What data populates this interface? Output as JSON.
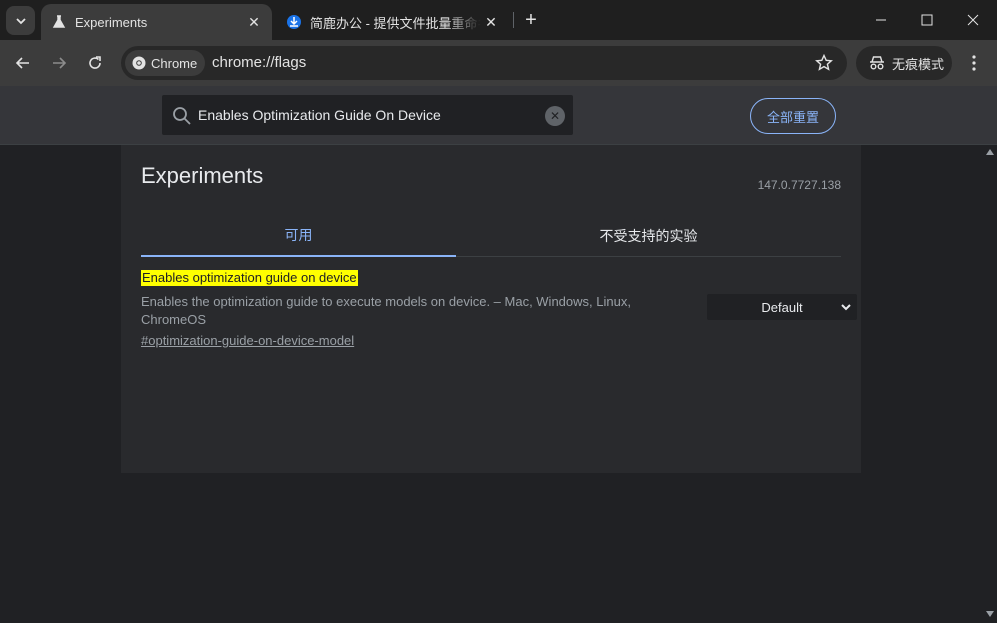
{
  "browser": {
    "tabs": [
      {
        "title": "Experiments",
        "favicon": "flask-icon",
        "active": true
      },
      {
        "title": "简鹿办公 - 提供文件批量重命名",
        "favicon": "download-circle-icon",
        "active": false
      }
    ],
    "omnibox": {
      "chip_label": "Chrome",
      "url": "chrome://flags"
    },
    "incognito_label": "无痕模式"
  },
  "flags_header": {
    "search_value": "Enables Optimization Guide On Device",
    "reset_label": "全部重置"
  },
  "page": {
    "title": "Experiments",
    "version": "147.0.7727.138",
    "tabs": [
      {
        "label": "可用",
        "selected": true
      },
      {
        "label": "不受支持的实验",
        "selected": false
      }
    ],
    "flag": {
      "name": "Enables optimization guide on device",
      "description": "Enables the optimization guide to execute models on device. – Mac, Windows, Linux, ChromeOS",
      "link": "#optimization-guide-on-device-model",
      "selected_option": "Default"
    }
  },
  "colors": {
    "accent": "#8ab4f8",
    "highlight": "#ffff00",
    "background": "#202124"
  }
}
